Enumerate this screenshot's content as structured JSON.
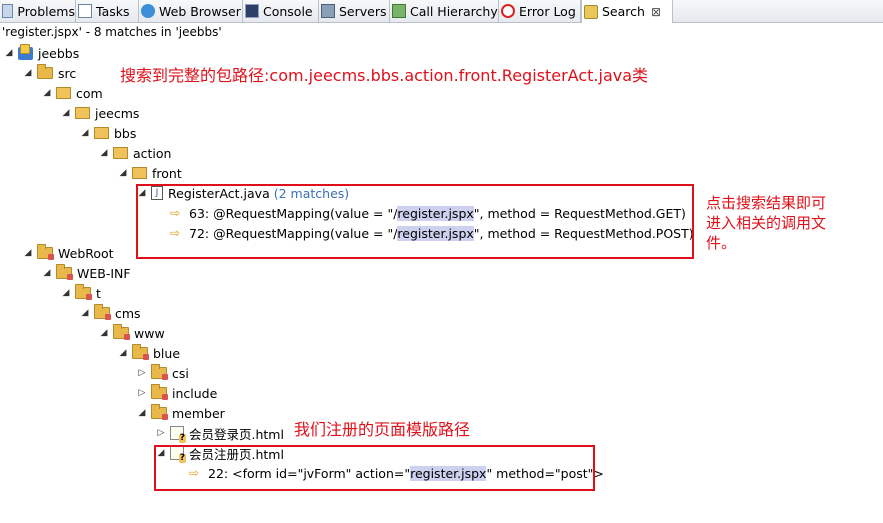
{
  "tabs": [
    {
      "label": "Problems",
      "icon": "problems-icon"
    },
    {
      "label": "Tasks",
      "icon": "tasks-icon"
    },
    {
      "label": "Web Browser",
      "icon": "globe-icon"
    },
    {
      "label": "Console",
      "icon": "console-icon"
    },
    {
      "label": "Servers",
      "icon": "servers-icon"
    },
    {
      "label": "Call Hierarchy",
      "icon": "call-hierarchy-icon"
    },
    {
      "label": "Error Log",
      "icon": "error-log-icon"
    },
    {
      "label": "Search",
      "icon": "search-icon",
      "active": true,
      "close": "⊠"
    }
  ],
  "summary": "'register.jspx' - 8 matches in 'jeebbs'",
  "tree": {
    "jeebbs": "jeebbs",
    "src": "src",
    "com": "com",
    "jeecms": "jeecms",
    "bbs": "bbs",
    "action": "action",
    "front": "front",
    "registerAct": "RegisterAct.java",
    "registerAct_count": "(2 matches)",
    "match63_pre": "63: @RequestMapping(value = \"/",
    "match63_hl": "register.jspx",
    "match63_post": "\", method = RequestMethod.GET)",
    "match72_pre": "72: @RequestMapping(value = \"/",
    "match72_hl": "register.jspx",
    "match72_post": "\", method = RequestMethod.POST)",
    "webroot": "WebRoot",
    "webinf": "WEB-INF",
    "t": "t",
    "cms": "cms",
    "www": "www",
    "blue": "blue",
    "csi": "csi",
    "include": "include",
    "member": "member",
    "login_html": "会员登录页.html",
    "register_html": "会员注册页.html",
    "match22_pre": "22: <form id=\"jvForm\" action=\"",
    "match22_hl": "register.jspx",
    "match22_post": "\" method=\"post\">"
  },
  "annotations": {
    "top": "搜索到完整的包路径:com.jeecms.bbs.action.front.RegisterAct.java类",
    "right_line1": "点击搜索结果即可",
    "right_line2": "进入相关的调用文",
    "right_line3": "件。",
    "bottom": "我们注册的页面模版路径"
  },
  "colors": {
    "annotation": "#e0101a",
    "match_count": "#3b6fb6",
    "highlight": "#cdd0ef"
  }
}
